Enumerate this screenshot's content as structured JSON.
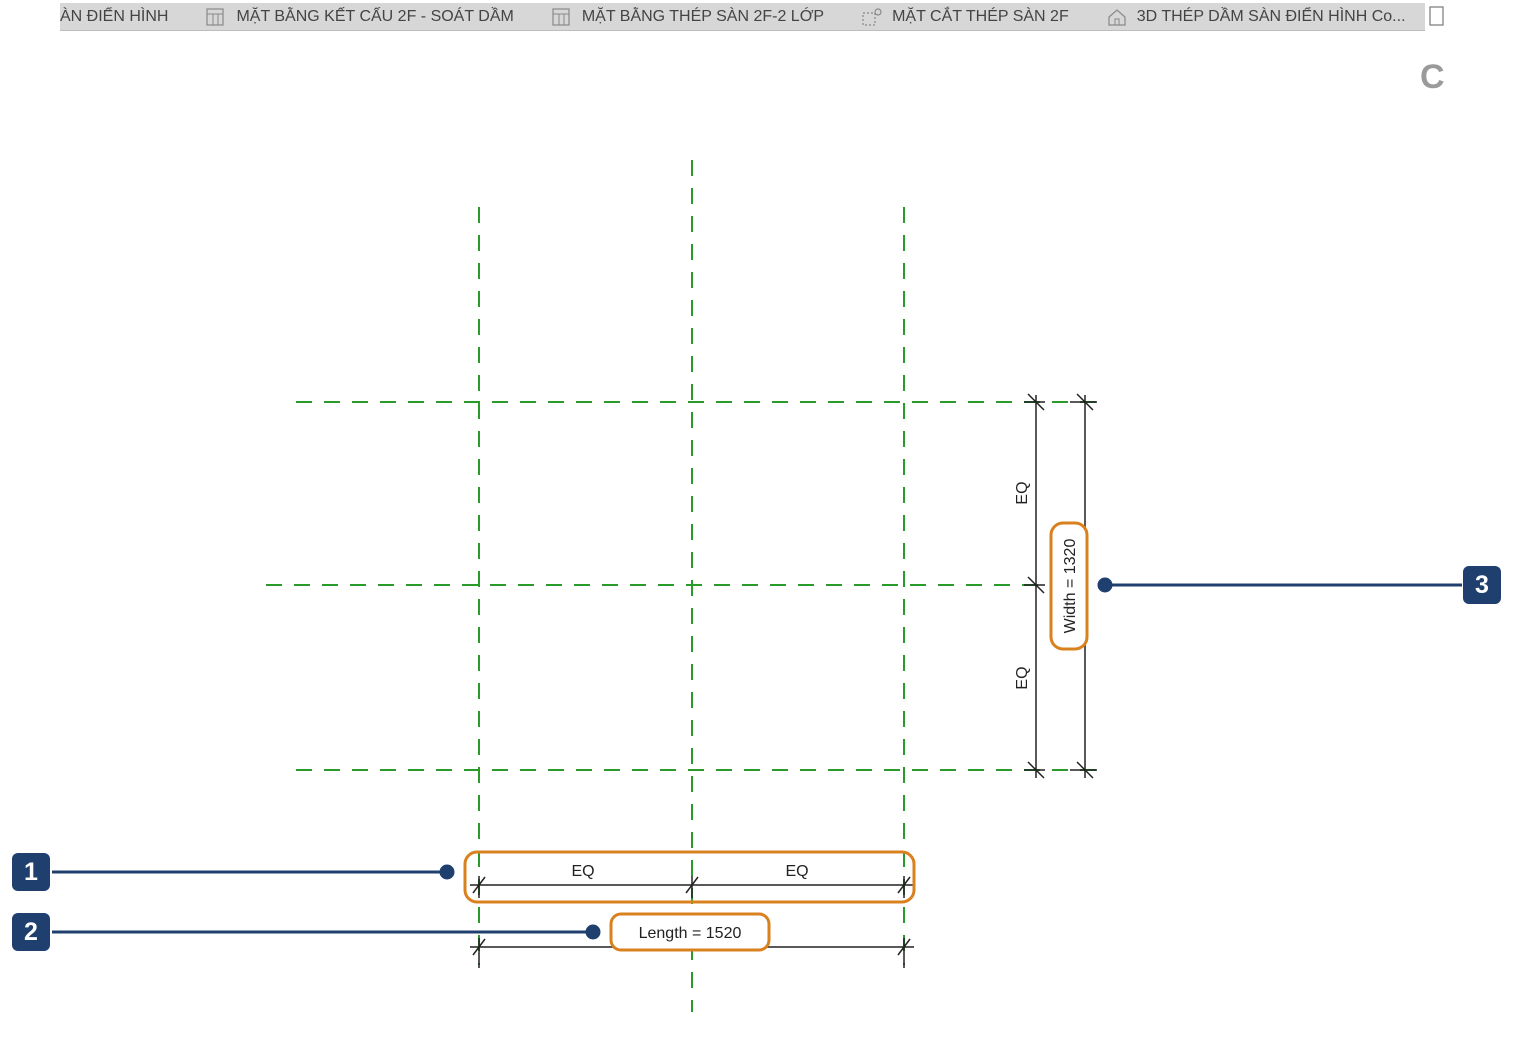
{
  "tabs": [
    {
      "label": "ÀN ĐIỂN HÌNH",
      "icon": "none"
    },
    {
      "label": "MẶT BẰNG KẾT CẤU 2F - SOÁT DẦM",
      "icon": "floor-plan-icon"
    },
    {
      "label": "MẶT BẰNG THÉP SÀN 2F-2 LỚP",
      "icon": "floor-plan-icon"
    },
    {
      "label": "MẶT CẮT THÉP SÀN 2F",
      "icon": "section-view-icon"
    },
    {
      "label": "3D THÉP DẦM SÀN ĐIỂN HÌNH Co...",
      "icon": "3d-house-icon"
    }
  ],
  "overflow_glyph": "C",
  "dimensions": {
    "eq_label": "EQ",
    "length_label": "Length = 1520",
    "width_label": "Width = 1320"
  },
  "callouts": [
    "1",
    "2",
    "3"
  ],
  "colors": {
    "grid_line": "#2a9a2a",
    "dimension_line": "#222222",
    "highlight": "#d9801f",
    "callout": "#1f3f6e"
  }
}
